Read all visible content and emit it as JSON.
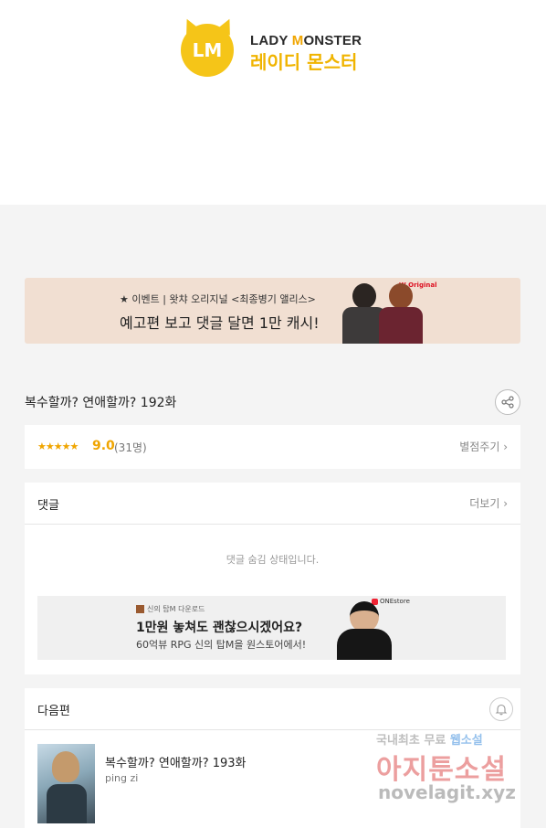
{
  "logo": {
    "badge_text": "LM",
    "english_a": "LADY ",
    "english_m": "M",
    "english_b": "ONSTER",
    "korean": "레이디 몬스터"
  },
  "banner": {
    "line1": "★ 이벤트 | 왓챠 오리지널 <최종병기 앨리스>",
    "line2": "예고편 보고 댓글 달면 1만 캐시!",
    "badge": "W Original"
  },
  "episode": {
    "title": "복수할까? 연애할까? 192화"
  },
  "rating": {
    "stars": "★★★★★",
    "score": "9.0",
    "count": "(31명)",
    "rate_label": "별점주기 ›"
  },
  "comments": {
    "label": "댓글",
    "more": "더보기 ›",
    "hidden_message": "댓글 숨김 상태입니다."
  },
  "ad": {
    "sub": "신의 탑M 다운로드",
    "main": "1만원 놓쳐도 괜찮으시겠어요?",
    "desc": "60억뷰 RPG 신의 탑M을 원스토어에서!",
    "brand": "ONEstore"
  },
  "next": {
    "label": "다음편",
    "title": "복수할까? 연애할까? 193화",
    "author": "ping zi"
  },
  "watermark": {
    "line1_a": "국내최초 무료 ",
    "line1_b": "웹소설",
    "line2": "아지툰소설",
    "line3": "novelagit.xyz"
  },
  "colors": {
    "accent": "#f0a500",
    "page_bg": "#f4f4f4",
    "banner_bg": "#f1dfd2"
  }
}
